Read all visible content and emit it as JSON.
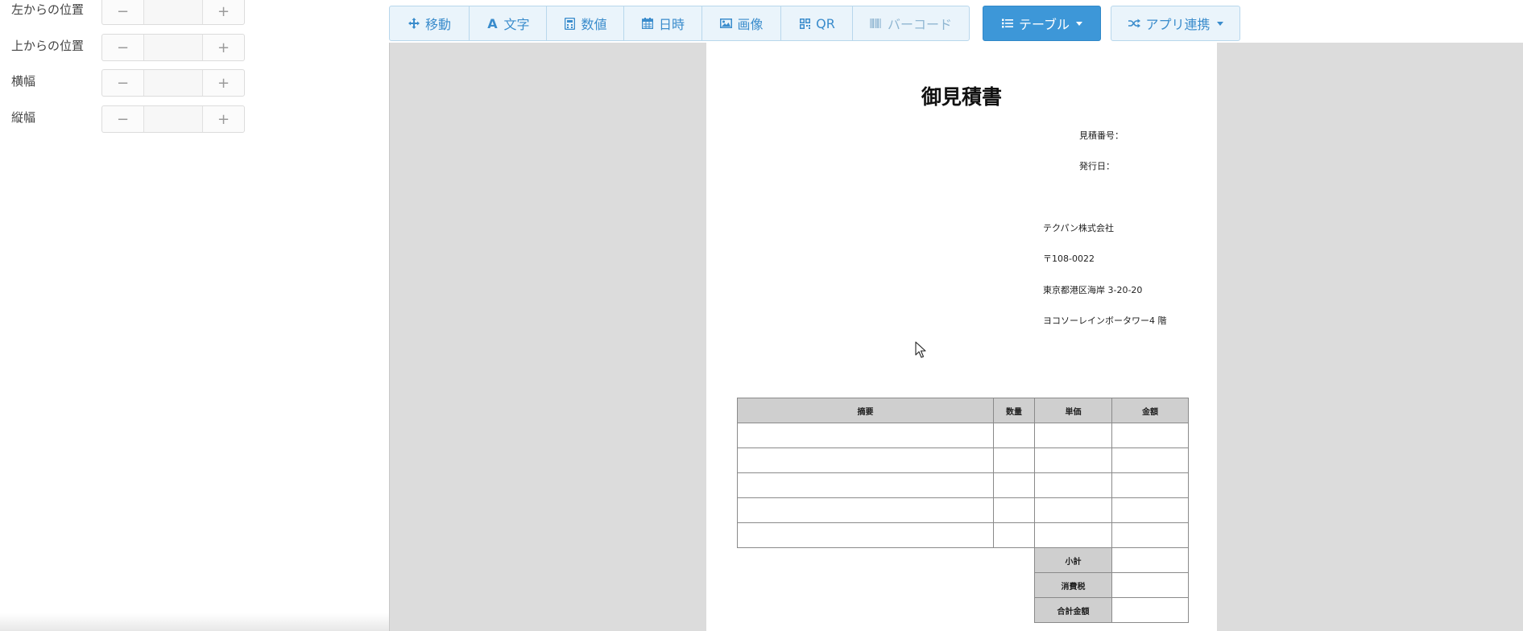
{
  "properties": [
    {
      "label": "左からの位置",
      "value": ""
    },
    {
      "label": "上からの位置",
      "value": ""
    },
    {
      "label": "横幅",
      "value": ""
    },
    {
      "label": "縦幅",
      "value": ""
    }
  ],
  "stepper": {
    "minus": "−",
    "plus": "+"
  },
  "toolbar": {
    "move": "移動",
    "text": "文字",
    "number": "数値",
    "datetime": "日時",
    "image": "画像",
    "qr": "QR",
    "barcode": "バーコード",
    "table": "テーブル",
    "app_integration": "アプリ連携"
  },
  "document": {
    "title": "御見積書",
    "quote_number_label": "見積番号：",
    "issue_date_label": "発行日：",
    "company_name": "テクパン株式会社",
    "postal_code": "〒108-0022",
    "address": "東京都港区海岸 3-20-20",
    "building": "ヨコソーレインボータワー4 階"
  },
  "table": {
    "headers": [
      "摘要",
      "数量",
      "単価",
      "金額"
    ],
    "body_rows": 5,
    "summary": [
      "小計",
      "消費税",
      "合計金額"
    ]
  },
  "colors": {
    "accent": "#3d97d8",
    "toolbar_bg": "#eaf4fb",
    "canvas_bg": "#dcdcdc",
    "header_gray": "#cfcfcf"
  }
}
